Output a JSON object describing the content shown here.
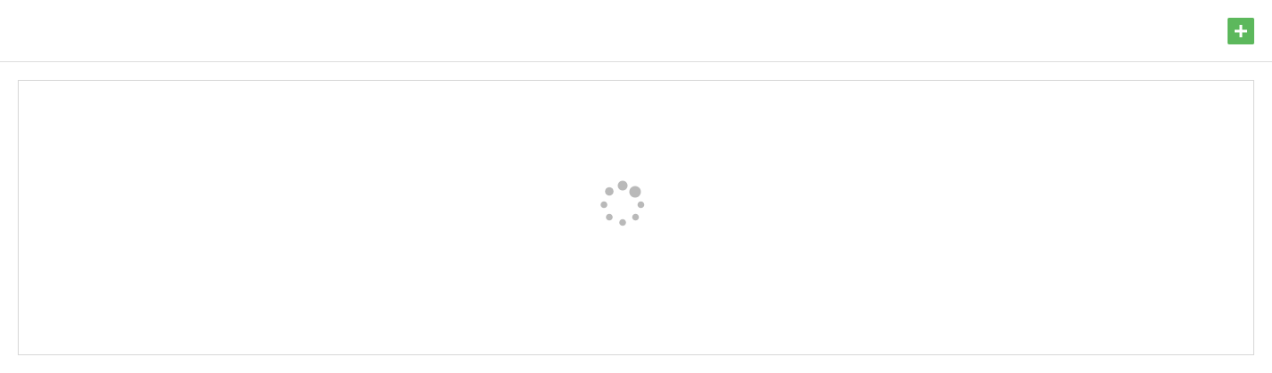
{
  "toolbar": {
    "add_button": {
      "icon": "plus-icon",
      "color": "#5cb85c"
    }
  },
  "content": {
    "state": "loading",
    "spinner": {
      "icon": "loading-spinner-icon",
      "color": "#b9b9b9"
    }
  }
}
